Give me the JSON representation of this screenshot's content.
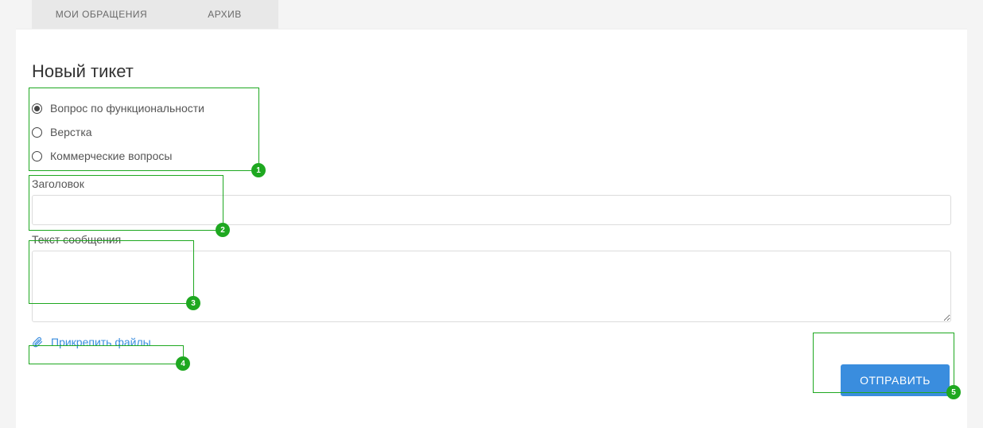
{
  "tabs": {
    "my_requests": "МОИ ОБРАЩЕНИЯ",
    "archive": "АРХИВ"
  },
  "page_title": "Новый тикет",
  "ticket_types": [
    {
      "label": "Вопрос по функциональности",
      "checked": true
    },
    {
      "label": "Верстка",
      "checked": false
    },
    {
      "label": "Коммерческие вопросы",
      "checked": false
    }
  ],
  "fields": {
    "title_label": "Заголовок",
    "title_value": "",
    "message_label": "Текст сообщения",
    "message_value": ""
  },
  "attach_label": "Прикрепить файлы",
  "submit_label": "ОТПРАВИТЬ",
  "annotations": {
    "1": "1",
    "2": "2",
    "3": "3",
    "4": "4",
    "5": "5"
  }
}
